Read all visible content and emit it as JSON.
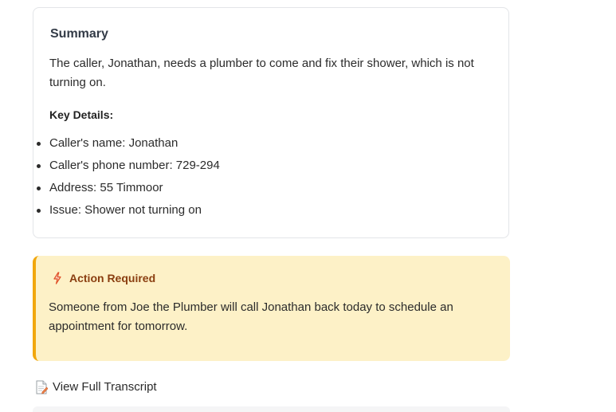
{
  "summary": {
    "title": "Summary",
    "text": "The caller, Jonathan, needs a plumber to come and fix their shower, which is not turning on.",
    "key_details_label": "Key Details:",
    "details": [
      "Caller's name: Jonathan",
      "Caller's phone number: 729-294",
      "Address: 55 Timmoor",
      "Issue: Shower not turning on"
    ]
  },
  "action": {
    "icon": "lightning-bolt-icon",
    "title": "Action Required",
    "text": "Someone from Joe the Plumber will call Jonathan back today to schedule an appointment for tomorrow.",
    "colors": {
      "background": "#fdf1c7",
      "border": "#f1a70d",
      "title": "#8a3e10"
    }
  },
  "transcript": {
    "icon": "document-icon",
    "label": "View Full Transcript"
  }
}
